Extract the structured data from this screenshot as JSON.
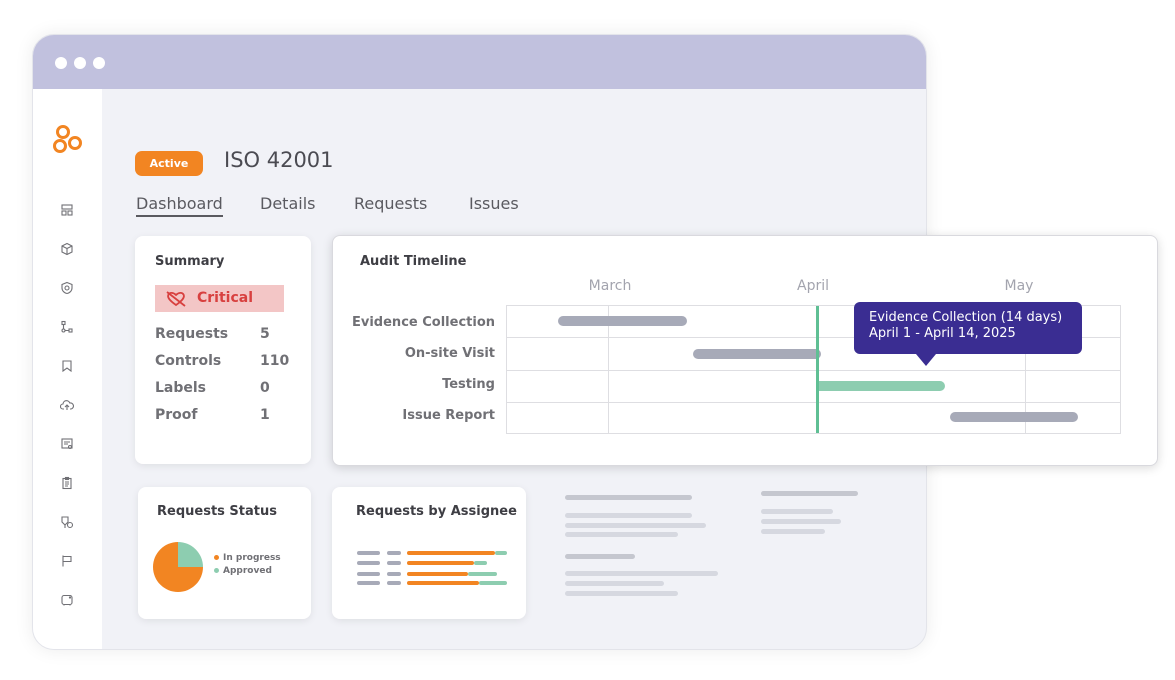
{
  "window": {
    "dots": 3
  },
  "sidebar": {
    "logo": "company-logo",
    "items": [
      {
        "icon": "dashboard-icon"
      },
      {
        "icon": "package-icon"
      },
      {
        "icon": "shield-icon"
      },
      {
        "icon": "workflow-icon"
      },
      {
        "icon": "bookmark-icon"
      },
      {
        "icon": "cloud-upload-icon"
      },
      {
        "icon": "certificate-icon"
      },
      {
        "icon": "clipboard-icon"
      },
      {
        "icon": "settings-tag-icon"
      },
      {
        "icon": "flag-icon"
      },
      {
        "icon": "archive-icon"
      }
    ]
  },
  "header": {
    "status_badge": "Active",
    "title": "ISO 42001"
  },
  "tabs": [
    {
      "label": "Dashboard",
      "active": true
    },
    {
      "label": "Details",
      "active": false
    },
    {
      "label": "Requests",
      "active": false
    },
    {
      "label": "Issues",
      "active": false
    }
  ],
  "summary": {
    "title": "Summary",
    "severity": "Critical",
    "rows": [
      {
        "label": "Requests",
        "value": "5"
      },
      {
        "label": "Controls",
        "value": "110"
      },
      {
        "label": "Labels",
        "value": "0"
      },
      {
        "label": "Proof",
        "value": "1"
      }
    ]
  },
  "timeline": {
    "title": "Audit Timeline",
    "months": [
      "March",
      "April",
      "May"
    ],
    "rows": [
      "Evidence Collection",
      "On-site Visit",
      "Testing",
      "Issue Report"
    ],
    "tooltip_line1": "Evidence Collection (14 days)",
    "tooltip_line2": "April 1 - April 14, 2025",
    "colors": {
      "bar": "#a7aab8",
      "active": "#8dcdb0",
      "today": "#5fbf94",
      "tooltip": "#3a2d92"
    }
  },
  "requests_status": {
    "title": "Requests Status",
    "legend": [
      {
        "label": "In progress",
        "color": "#f28522"
      },
      {
        "label": "Approved",
        "color": "#8dcdb0"
      }
    ]
  },
  "requests_by_assignee": {
    "title": "Requests by Assignee"
  },
  "chart_data": [
    {
      "type": "gantt",
      "title": "Audit Timeline",
      "x_ticks": [
        "March",
        "April",
        "May"
      ],
      "tasks": [
        {
          "name": "Evidence Collection",
          "start": "early March",
          "end": "mid March",
          "highlighted": false
        },
        {
          "name": "On-site Visit",
          "start": "mid March",
          "end": "April 1",
          "highlighted": false
        },
        {
          "name": "Testing",
          "start": "April 1",
          "end": "April 14",
          "highlighted": true
        },
        {
          "name": "Issue Report",
          "start": "mid April",
          "end": "early May",
          "highlighted": false
        }
      ],
      "marker": "April 1"
    },
    {
      "type": "pie",
      "title": "Requests Status",
      "slices": [
        {
          "label": "In progress",
          "value": 75
        },
        {
          "label": "Approved",
          "value": 25
        }
      ]
    },
    {
      "type": "bar",
      "title": "Requests by Assignee",
      "orientation": "horizontal-stacked",
      "series": [
        {
          "name": "In progress",
          "values": [
            88,
            67,
            61,
            72
          ]
        },
        {
          "name": "Approved",
          "values": [
            12,
            13,
            29,
            28
          ]
        }
      ]
    }
  ]
}
